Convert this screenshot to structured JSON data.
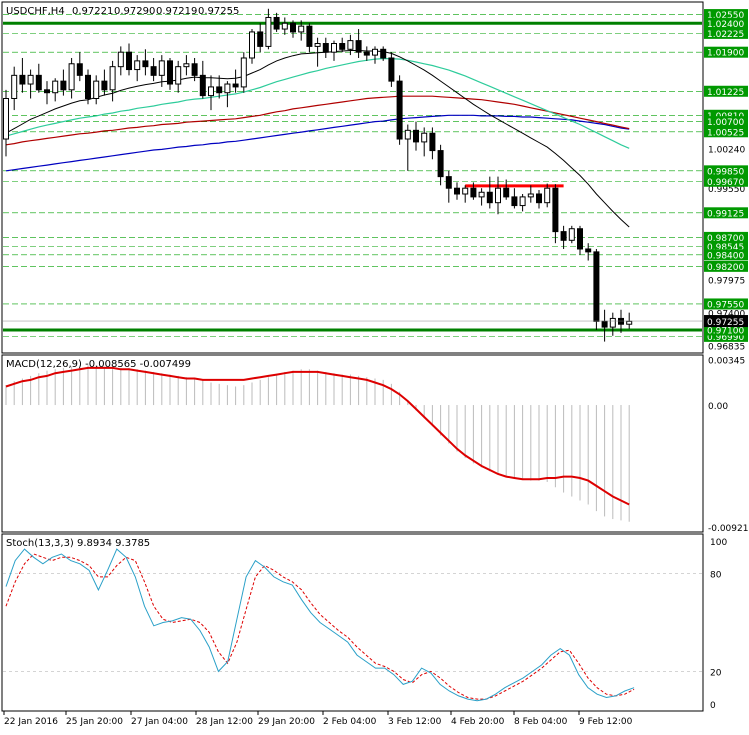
{
  "colors": {
    "bg": "#ffffff",
    "frame": "#000000",
    "grid_green": "#00a000",
    "level_green": "#008000",
    "resistance_red": "#ff0000",
    "ma_black": "#000000",
    "ma_teal": "#2ecc9b",
    "ma_darkred": "#b00000",
    "ma_blue": "#0000c0",
    "macd_line": "#dd0000",
    "macd_hist": "#bbbbbb",
    "stoch_main": "#2aa0c8",
    "stoch_signal": "#dd0000",
    "price_badge_bg": "#000000",
    "price_badge_fg": "#ffffff",
    "level_badge_bg": "#009900",
    "level_badge_fg": "#ffffff"
  },
  "chart_data": [
    {
      "type": "candlestick",
      "title": "USDCHF,H4",
      "ohlc_readout": [
        "0.97221",
        "0.97290",
        "0.97219",
        "0.97255"
      ],
      "ylim": [
        0.9672,
        1.0275
      ],
      "y_ticks": [
        "1.02550",
        "1.02400",
        "1.02225",
        "1.01900",
        "1.01225",
        "1.00810",
        "1.00700",
        "1.00525",
        "1.00240",
        "0.99850",
        "0.99670",
        "0.99550",
        "0.99125",
        "0.98700",
        "0.98545",
        "0.98400",
        "0.98200",
        "0.97975",
        "0.97550",
        "0.97400",
        "0.97255",
        "0.97100",
        "0.96990",
        "0.96835"
      ],
      "x_labels": [
        "22 Jan 2016",
        "25 Jan 20:00",
        "27 Jan 04:00",
        "28 Jan 12:00",
        "29 Jan 20:00",
        "2 Feb 04:00",
        "3 Feb 12:00",
        "4 Feb 20:00",
        "8 Feb 04:00",
        "9 Feb 12:00"
      ],
      "current_price": 0.97255,
      "support_level": 0.971,
      "resistance_top": 1.024,
      "resistance_mid": {
        "value": 0.9959,
        "from_bar": 56,
        "to_bar": 68
      },
      "dashed_levels": [
        1.0255,
        1.02225,
        1.019,
        1.01225,
        1.0081,
        1.007,
        1.00525,
        0.9985,
        0.9967,
        0.99125,
        0.987,
        0.98545,
        0.984,
        0.982,
        0.9755,
        0.9699
      ],
      "candles": [
        [
          1.004,
          1.0125,
          1.001,
          1.011
        ],
        [
          1.011,
          1.0165,
          1.009,
          1.015
        ],
        [
          1.015,
          1.018,
          1.012,
          1.0135
        ],
        [
          1.0135,
          1.016,
          1.011,
          1.015
        ],
        [
          1.015,
          1.017,
          1.012,
          1.0125
        ],
        [
          1.0125,
          1.014,
          1.01,
          1.012
        ],
        [
          1.012,
          1.0145,
          1.0105,
          1.014
        ],
        [
          1.014,
          1.016,
          1.0115,
          1.0125
        ],
        [
          1.0125,
          1.018,
          1.011,
          1.017
        ],
        [
          1.017,
          1.019,
          1.014,
          1.015
        ],
        [
          1.015,
          1.016,
          1.01,
          1.011
        ],
        [
          1.011,
          1.015,
          1.01,
          1.014
        ],
        [
          1.014,
          1.016,
          1.0115,
          1.0125
        ],
        [
          1.0125,
          1.0175,
          1.0105,
          1.0165
        ],
        [
          1.0165,
          1.02,
          1.015,
          1.019
        ],
        [
          1.019,
          1.0205,
          1.015,
          1.016
        ],
        [
          1.016,
          1.0185,
          1.014,
          1.0175
        ],
        [
          1.0175,
          1.0195,
          1.015,
          1.0165
        ],
        [
          1.0165,
          1.018,
          1.014,
          1.015
        ],
        [
          1.015,
          1.0185,
          1.013,
          1.0175
        ],
        [
          1.0175,
          1.018,
          1.0125,
          1.0135
        ],
        [
          1.0135,
          1.0175,
          1.012,
          1.0165
        ],
        [
          1.0165,
          1.0185,
          1.015,
          1.017
        ],
        [
          1.017,
          1.018,
          1.014,
          1.015
        ],
        [
          1.015,
          1.0175,
          1.011,
          1.0115
        ],
        [
          1.0115,
          1.015,
          1.009,
          1.013
        ],
        [
          1.013,
          1.015,
          1.011,
          1.012
        ],
        [
          1.012,
          1.014,
          1.0095,
          1.0135
        ],
        [
          1.0135,
          1.016,
          1.012,
          1.013
        ],
        [
          1.013,
          1.019,
          1.012,
          1.018
        ],
        [
          1.018,
          1.023,
          1.017,
          1.0225
        ],
        [
          1.0225,
          1.024,
          1.019,
          1.02
        ],
        [
          1.02,
          1.0265,
          1.0195,
          1.025
        ],
        [
          1.025,
          1.0258,
          1.0225,
          1.023
        ],
        [
          1.023,
          1.025,
          1.022,
          1.024
        ],
        [
          1.024,
          1.0245,
          1.0215,
          1.0225
        ],
        [
          1.0225,
          1.0245,
          1.021,
          1.0235
        ],
        [
          1.0235,
          1.024,
          1.019,
          1.02
        ],
        [
          1.02,
          1.0215,
          1.0165,
          1.0205
        ],
        [
          1.0205,
          1.0215,
          1.018,
          1.019
        ],
        [
          1.019,
          1.021,
          1.0175,
          1.0205
        ],
        [
          1.0205,
          1.0215,
          1.019,
          1.0195
        ],
        [
          1.0195,
          1.022,
          1.0185,
          1.021
        ],
        [
          1.021,
          1.023,
          1.018,
          1.019
        ],
        [
          1.019,
          1.02,
          1.0175,
          1.0185
        ],
        [
          1.0185,
          1.02,
          1.017,
          1.0195
        ],
        [
          1.0195,
          1.02,
          1.0175,
          1.018
        ],
        [
          1.018,
          1.019,
          1.013,
          1.014
        ],
        [
          1.014,
          1.015,
          1.003,
          1.004
        ],
        [
          1.004,
          1.0065,
          0.9985,
          1.0055
        ],
        [
          1.0055,
          1.007,
          1.002,
          1.0035
        ],
        [
          1.0035,
          1.006,
          1.001,
          1.005
        ],
        [
          1.005,
          1.006,
          1.0005,
          1.002
        ],
        [
          1.002,
          1.003,
          0.996,
          0.9975
        ],
        [
          0.9975,
          0.9985,
          0.993,
          0.9955
        ],
        [
          0.9955,
          0.9965,
          0.9935,
          0.9945
        ],
        [
          0.9945,
          0.996,
          0.993,
          0.9955
        ],
        [
          0.9955,
          0.9965,
          0.9935,
          0.994
        ],
        [
          0.994,
          0.9955,
          0.9925,
          0.9948
        ],
        [
          0.9948,
          0.9975,
          0.992,
          0.993
        ],
        [
          0.993,
          0.9975,
          0.991,
          0.9955
        ],
        [
          0.9955,
          0.997,
          0.9935,
          0.994
        ],
        [
          0.994,
          0.9955,
          0.992,
          0.9925
        ],
        [
          0.9925,
          0.9945,
          0.9915,
          0.994
        ],
        [
          0.994,
          0.996,
          0.993,
          0.9945
        ],
        [
          0.9945,
          0.9952,
          0.992,
          0.993
        ],
        [
          0.993,
          0.9963,
          0.9922,
          0.9955
        ],
        [
          0.9955,
          0.9962,
          0.986,
          0.988
        ],
        [
          0.988,
          0.989,
          0.985,
          0.9865
        ],
        [
          0.9865,
          0.989,
          0.986,
          0.9885
        ],
        [
          0.9885,
          0.989,
          0.984,
          0.985
        ],
        [
          0.985,
          0.986,
          0.983,
          0.9845
        ],
        [
          0.9845,
          0.985,
          0.971,
          0.9725
        ],
        [
          0.9725,
          0.9745,
          0.969,
          0.9715
        ],
        [
          0.9715,
          0.974,
          0.97,
          0.973
        ],
        [
          0.973,
          0.9745,
          0.9705,
          0.972
        ],
        [
          0.972,
          0.974,
          0.9712,
          0.9725
        ]
      ],
      "ma_black": [
        1.005,
        1.0058,
        1.0066,
        1.0074,
        1.008,
        1.0086,
        1.0092,
        1.0097,
        1.0102,
        1.0106,
        1.0108,
        1.0112,
        1.0116,
        1.0119,
        1.0124,
        1.0128,
        1.0131,
        1.0134,
        1.0136,
        1.0139,
        1.014,
        1.0142,
        1.0145,
        1.0147,
        1.0146,
        1.0146,
        1.0145,
        1.0144,
        1.0145,
        1.0148,
        1.0154,
        1.016,
        1.0168,
        1.0175,
        1.018,
        1.0184,
        1.0187,
        1.0188,
        1.0189,
        1.019,
        1.0191,
        1.0192,
        1.0193,
        1.0193,
        1.0192,
        1.0192,
        1.0191,
        1.0188,
        1.0182,
        1.0175,
        1.0167,
        1.0159,
        1.015,
        1.014,
        1.013,
        1.012,
        1.011,
        1.01,
        1.0091,
        1.0082,
        1.0074,
        1.0066,
        1.0058,
        1.005,
        1.0042,
        1.0034,
        1.0026,
        1.0015,
        1.0003,
        0.999,
        0.9977,
        0.9962,
        0.9945,
        0.993,
        0.9915,
        0.9901,
        0.9888
      ],
      "ma_teal": [
        1.0045,
        1.0049,
        1.0053,
        1.0057,
        1.0061,
        1.0064,
        1.0067,
        1.007,
        1.0073,
        1.0076,
        1.0078,
        1.008,
        1.0083,
        1.0085,
        1.0088,
        1.009,
        1.0093,
        1.0095,
        1.0097,
        1.01,
        1.0102,
        1.0104,
        1.0107,
        1.0109,
        1.011,
        1.0112,
        1.0114,
        1.0116,
        1.0118,
        1.0121,
        1.0125,
        1.0129,
        1.0134,
        1.0139,
        1.0143,
        1.0147,
        1.0151,
        1.0155,
        1.0158,
        1.0162,
        1.0165,
        1.0168,
        1.0171,
        1.0174,
        1.0176,
        1.0178,
        1.0179,
        1.0179,
        1.0178,
        1.0176,
        1.0173,
        1.017,
        1.0167,
        1.0163,
        1.0159,
        1.0154,
        1.0149,
        1.0143,
        1.0137,
        1.0131,
        1.0125,
        1.0119,
        1.0113,
        1.0107,
        1.0101,
        1.0095,
        1.0089,
        1.0083,
        1.0077,
        1.0071,
        1.0065,
        1.0058,
        1.0051,
        1.0044,
        1.0037,
        1.003,
        1.0024
      ],
      "ma_darkred": [
        1.003,
        1.0032,
        1.0035,
        1.0037,
        1.0039,
        1.0041,
        1.0043,
        1.0045,
        1.0047,
        1.0049,
        1.005,
        1.0052,
        1.0054,
        1.0055,
        1.0057,
        1.0059,
        1.006,
        1.0062,
        1.0063,
        1.0065,
        1.0066,
        1.0067,
        1.0069,
        1.007,
        1.0071,
        1.0072,
        1.0073,
        1.0074,
        1.0075,
        1.0077,
        1.0079,
        1.0081,
        1.0084,
        1.0087,
        1.0089,
        1.0092,
        1.0094,
        1.0096,
        1.0098,
        1.01,
        1.0102,
        1.0104,
        1.0106,
        1.0108,
        1.011,
        1.0111,
        1.0112,
        1.0113,
        1.0114,
        1.0114,
        1.0114,
        1.0114,
        1.0114,
        1.0113,
        1.0112,
        1.0111,
        1.011,
        1.0109,
        1.0108,
        1.0106,
        1.0104,
        1.0102,
        1.01,
        1.0097,
        1.0094,
        1.0091,
        1.0088,
        1.0085,
        1.0082,
        1.0079,
        1.0076,
        1.0073,
        1.007,
        1.0067,
        1.0064,
        1.0061,
        1.0058
      ],
      "ma_blue": [
        0.9985,
        0.9987,
        0.9989,
        0.9991,
        0.9993,
        0.9995,
        0.9997,
        0.9999,
        1.0001,
        1.0003,
        1.0005,
        1.0007,
        1.0009,
        1.0011,
        1.0013,
        1.0015,
        1.0017,
        1.0019,
        1.0021,
        1.0022,
        1.0024,
        1.0026,
        1.0027,
        1.0029,
        1.003,
        1.0032,
        1.0033,
        1.0035,
        1.0036,
        1.0038,
        1.004,
        1.0042,
        1.0044,
        1.0046,
        1.0048,
        1.005,
        1.0052,
        1.0054,
        1.0056,
        1.0058,
        1.006,
        1.0062,
        1.0064,
        1.0066,
        1.0068,
        1.007,
        1.0071,
        1.0073,
        1.0075,
        1.0076,
        1.0077,
        1.0078,
        1.0079,
        1.008,
        1.0081,
        1.0081,
        1.0081,
        1.0081,
        1.008,
        1.008,
        1.008,
        1.0079,
        1.0079,
        1.0078,
        1.0078,
        1.0077,
        1.0076,
        1.0075,
        1.0074,
        1.0073,
        1.0071,
        1.0069,
        1.0067,
        1.0065,
        1.0062,
        1.0059,
        1.0057
      ]
    },
    {
      "type": "macd",
      "title": "MACD(12,26,9) -0.008565 -0.007499",
      "ylim": [
        -0.0095,
        0.0037
      ],
      "y_ticks": [
        "0.00345",
        "0.00",
        "-0.009211"
      ],
      "histogram": [
        0.0015,
        0.0018,
        0.002,
        0.0022,
        0.0024,
        0.0026,
        0.0027,
        0.0028,
        0.0029,
        0.003,
        0.003,
        0.003,
        0.0029,
        0.0029,
        0.0028,
        0.0028,
        0.0027,
        0.0026,
        0.0025,
        0.0024,
        0.0023,
        0.0022,
        0.0021,
        0.002,
        0.0019,
        0.0017,
        0.0016,
        0.0015,
        0.0014,
        0.0015,
        0.0017,
        0.0019,
        0.0021,
        0.0023,
        0.0025,
        0.0026,
        0.0027,
        0.0027,
        0.0026,
        0.0025,
        0.0024,
        0.0023,
        0.0023,
        0.0022,
        0.0021,
        0.002,
        0.0019,
        0.0016,
        0.001,
        0.0003,
        -0.0004,
        -0.001,
        -0.0016,
        -0.0023,
        -0.0029,
        -0.0035,
        -0.004,
        -0.0044,
        -0.0047,
        -0.005,
        -0.0052,
        -0.0054,
        -0.0055,
        -0.0056,
        -0.0057,
        -0.0057,
        -0.0058,
        -0.0062,
        -0.0066,
        -0.0069,
        -0.0072,
        -0.0075,
        -0.008,
        -0.0084,
        -0.0086,
        -0.0087,
        -0.0088
      ],
      "signal": [
        0.0014,
        0.0016,
        0.0018,
        0.0019,
        0.0021,
        0.0022,
        0.0024,
        0.0025,
        0.0026,
        0.0027,
        0.0028,
        0.0028,
        0.0028,
        0.0028,
        0.0027,
        0.0027,
        0.0026,
        0.0025,
        0.0024,
        0.0023,
        0.0022,
        0.0021,
        0.002,
        0.002,
        0.0019,
        0.0019,
        0.0019,
        0.0019,
        0.0019,
        0.0019,
        0.002,
        0.0021,
        0.0022,
        0.0023,
        0.0024,
        0.0025,
        0.0025,
        0.0025,
        0.0025,
        0.0024,
        0.0023,
        0.0022,
        0.0021,
        0.002,
        0.0019,
        0.0017,
        0.0015,
        0.0012,
        0.0008,
        0.0003,
        -0.0003,
        -0.0009,
        -0.0015,
        -0.0021,
        -0.0027,
        -0.0033,
        -0.0038,
        -0.0042,
        -0.0046,
        -0.0049,
        -0.0052,
        -0.0054,
        -0.0055,
        -0.0056,
        -0.0056,
        -0.0056,
        -0.0055,
        -0.0055,
        -0.0054,
        -0.0054,
        -0.0055,
        -0.0057,
        -0.0061,
        -0.0065,
        -0.0069,
        -0.0072,
        -0.0075
      ]
    },
    {
      "type": "stochastic",
      "title": "Stoch(13,3,3) 9.8934 9.3785",
      "ylim": [
        0,
        100
      ],
      "y_ticks": [
        "100",
        "80",
        "20",
        "0"
      ],
      "main": [
        72,
        88,
        95,
        90,
        86,
        90,
        92,
        88,
        86,
        82,
        70,
        82,
        95,
        90,
        78,
        60,
        48,
        50,
        51,
        53,
        52,
        45,
        35,
        20,
        26,
        52,
        78,
        88,
        84,
        78,
        75,
        73,
        64,
        56,
        50,
        46,
        42,
        38,
        30,
        26,
        22,
        22,
        18,
        12,
        14,
        22,
        19,
        12,
        8,
        5,
        3,
        2,
        3,
        6,
        10,
        13,
        16,
        20,
        24,
        30,
        34,
        30,
        18,
        10,
        6,
        4,
        5,
        8,
        10
      ],
      "signal": [
        60,
        75,
        86,
        92,
        90,
        88,
        90,
        90,
        88,
        85,
        78,
        78,
        85,
        90,
        88,
        75,
        60,
        52,
        50,
        51,
        52,
        50,
        44,
        32,
        25,
        38,
        58,
        78,
        85,
        82,
        78,
        75,
        70,
        62,
        55,
        50,
        45,
        41,
        35,
        30,
        25,
        23,
        20,
        15,
        13,
        18,
        20,
        16,
        11,
        7,
        4,
        3,
        3,
        5,
        8,
        11,
        14,
        18,
        22,
        27,
        32,
        33,
        25,
        16,
        10,
        6,
        5,
        6,
        9
      ]
    }
  ]
}
